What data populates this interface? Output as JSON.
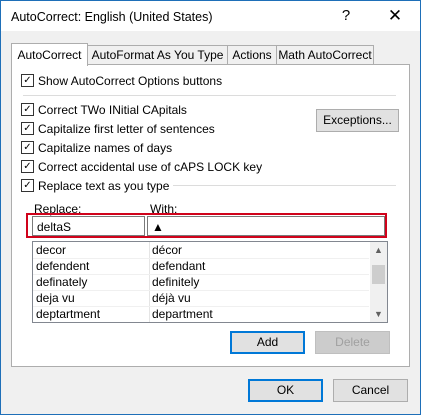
{
  "dialog": {
    "title": "AutoCorrect: English (United States)",
    "help_label": "?",
    "close_label": "✕"
  },
  "tabs": [
    {
      "label": "AutoCorrect",
      "active": true
    },
    {
      "label": "AutoFormat As You Type",
      "active": false
    },
    {
      "label": "Actions",
      "active": false
    },
    {
      "label": "Math AutoCorrect",
      "active": false
    }
  ],
  "options": {
    "show_buttons": "Show AutoCorrect Options buttons",
    "two_initial": "Correct TWo INitial CApitals",
    "first_letter": "Capitalize first letter of sentences",
    "names_days": "Capitalize names of days",
    "caps_lock": "Correct accidental use of cAPS LOCK key",
    "replace_text": "Replace text as you type"
  },
  "check_mark": "✓",
  "exceptions_button": "Exceptions...",
  "replace_label": "Replace:",
  "with_label": "With:",
  "replace_value": "deltaS",
  "with_value": "▲",
  "entries": [
    {
      "replace": "decor",
      "with": "décor"
    },
    {
      "replace": "defendent",
      "with": "defendant"
    },
    {
      "replace": "definately",
      "with": "definitely"
    },
    {
      "replace": "deja vu",
      "with": "déjà vu"
    },
    {
      "replace": "deptartment",
      "with": "department"
    }
  ],
  "scroll_up": "▲",
  "scroll_down": "▼",
  "add_button": "Add",
  "delete_button": "Delete",
  "ok_button": "OK",
  "cancel_button": "Cancel"
}
